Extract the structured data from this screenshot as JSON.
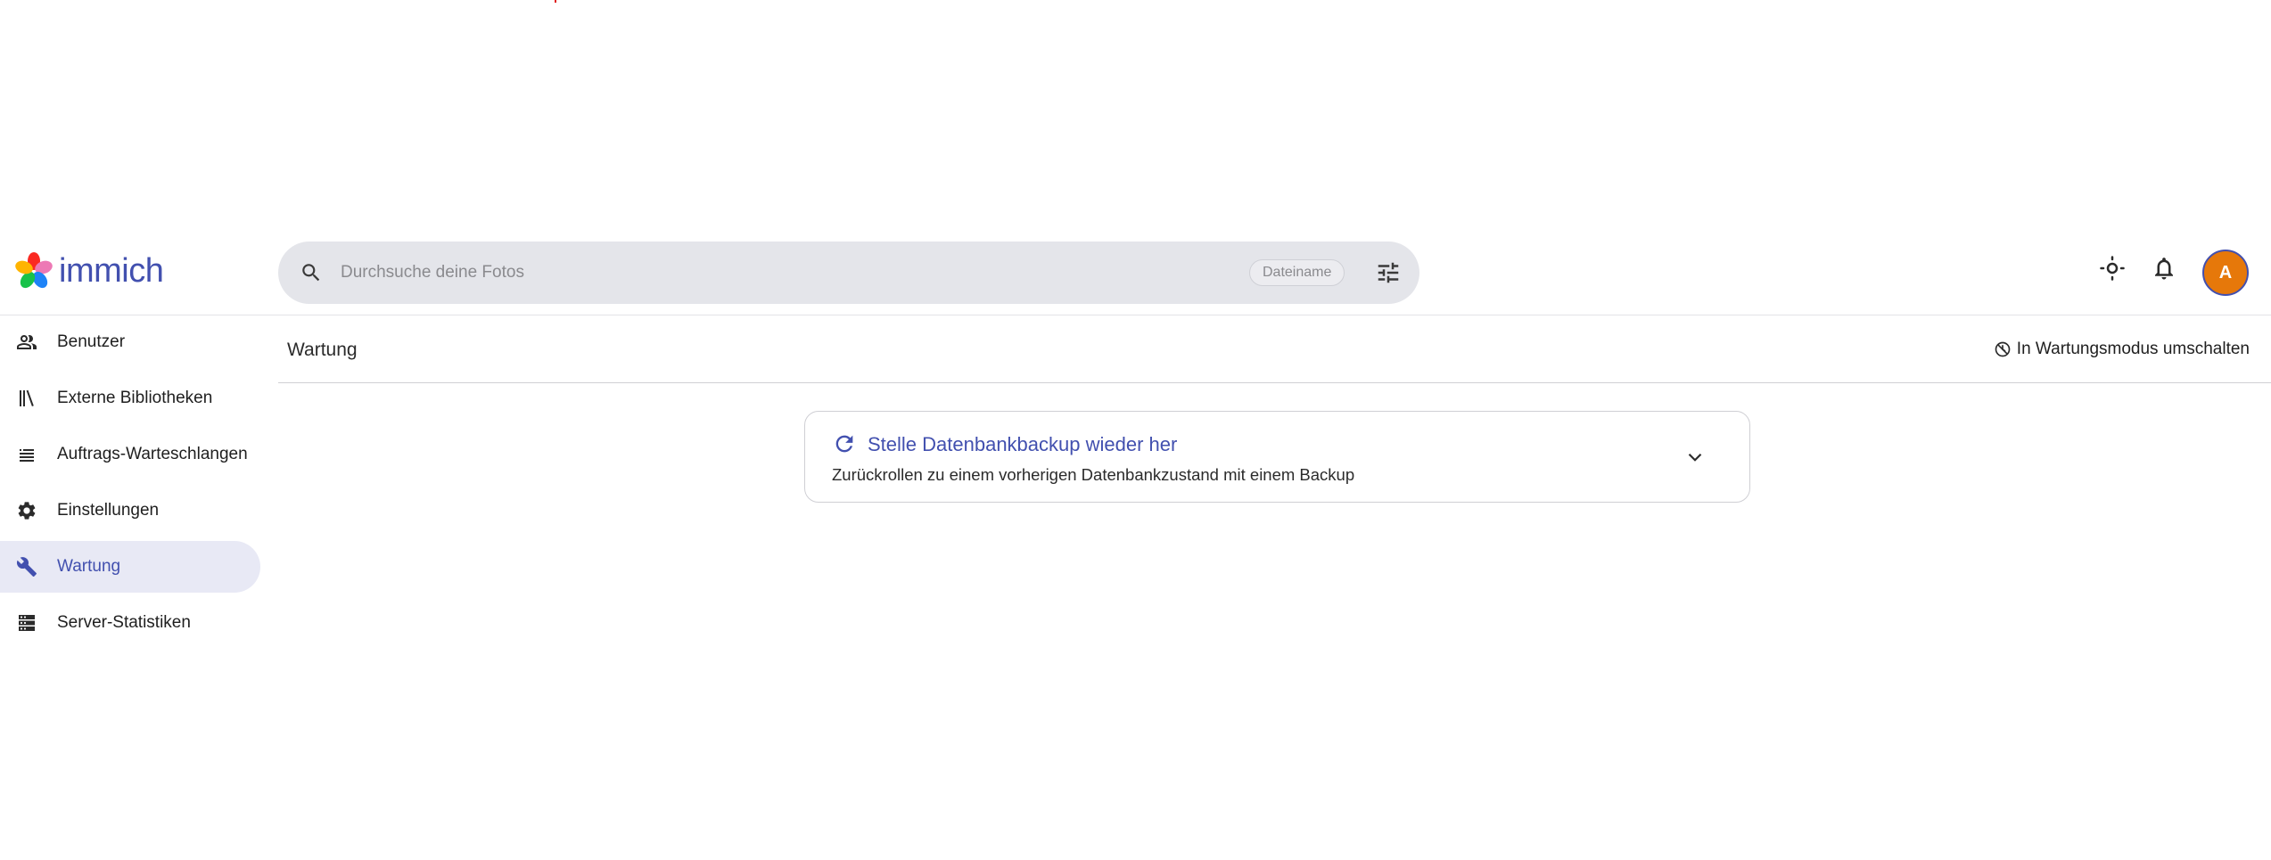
{
  "app": {
    "logo_text": "immich"
  },
  "search": {
    "placeholder": "Durchsuche deine Fotos",
    "filter_chip": "Dateiname"
  },
  "header": {
    "avatar_initial": "A"
  },
  "sidebar": {
    "items": [
      {
        "label": "Benutzer",
        "icon": "users-icon"
      },
      {
        "label": "Externe Bibliotheken",
        "icon": "library-icon"
      },
      {
        "label": "Auftrags-Warteschlangen",
        "icon": "queue-icon"
      },
      {
        "label": "Einstellungen",
        "icon": "gear-icon"
      },
      {
        "label": "Wartung",
        "icon": "wrench-icon",
        "active": true
      },
      {
        "label": "Server-Statistiken",
        "icon": "server-icon"
      }
    ]
  },
  "main": {
    "title": "Wartung",
    "maintenance_toggle_label": "In Wartungsmodus umschalten",
    "card": {
      "title": "Stelle Datenbankbackup wieder her",
      "description": "Zurückrollen zu einem vorherigen Datenbankzustand mit einem Backup"
    }
  },
  "colors": {
    "brand": "#4250af",
    "active_bg": "#e8e9f5",
    "search_bg": "#e4e5ea",
    "avatar_bg": "#e6780a"
  }
}
